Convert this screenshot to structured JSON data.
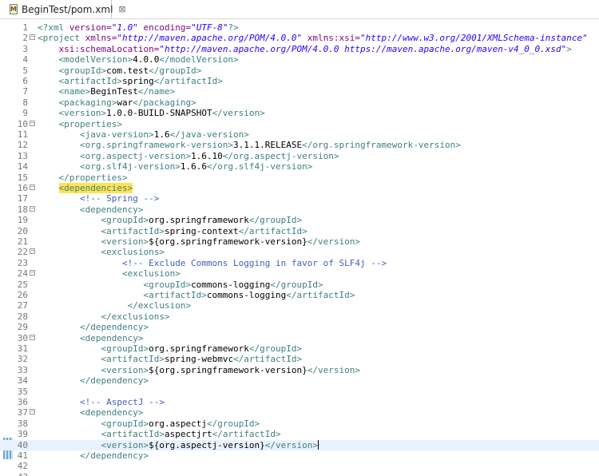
{
  "editor_tab": {
    "icon": "M",
    "title": "BeginTest/pom.xml",
    "close_glyph": "⊠"
  },
  "lines": [
    {
      "num": "1",
      "fold": "",
      "indent": "",
      "segs": [
        [
          "tag",
          "<?xml "
        ],
        [
          "attr",
          "version="
        ],
        [
          "val",
          "\"1.0\""
        ],
        [
          "attr",
          " encoding="
        ],
        [
          "val",
          "\"UTF-8\""
        ],
        [
          "tag",
          "?>"
        ]
      ]
    },
    {
      "num": "2",
      "fold": "⊖",
      "indent": "",
      "segs": [
        [
          "tag",
          "<project "
        ],
        [
          "attr",
          "xmlns="
        ],
        [
          "val",
          "\"http://maven.apache.org/POM/4.0.0\""
        ],
        [
          "attr",
          " xmlns:xsi="
        ],
        [
          "val",
          "\"http://www.w3.org/2001/XMLSchema-instance\""
        ]
      ]
    },
    {
      "num": "3",
      "fold": "",
      "indent": "    ",
      "segs": [
        [
          "attr",
          "xsi:schemaLocation="
        ],
        [
          "val",
          "\"http://maven.apache.org/POM/4.0.0 https://maven.apache.org/maven-v4_0_0.xsd\""
        ],
        [
          "tag",
          ">"
        ]
      ]
    },
    {
      "num": "4",
      "fold": "",
      "indent": "    ",
      "segs": [
        [
          "tag",
          "<modelVersion>"
        ],
        [
          "text",
          "4.0.0"
        ],
        [
          "tag",
          "</modelVersion>"
        ]
      ]
    },
    {
      "num": "5",
      "fold": "",
      "indent": "    ",
      "segs": [
        [
          "tag",
          "<groupId>"
        ],
        [
          "text",
          "com.test"
        ],
        [
          "tag",
          "</groupId>"
        ]
      ]
    },
    {
      "num": "6",
      "fold": "",
      "indent": "    ",
      "segs": [
        [
          "tag",
          "<artifactId>"
        ],
        [
          "text",
          "spring"
        ],
        [
          "tag",
          "</artifactId>"
        ]
      ]
    },
    {
      "num": "7",
      "fold": "",
      "indent": "    ",
      "segs": [
        [
          "tag",
          "<name>"
        ],
        [
          "text",
          "BeginTest"
        ],
        [
          "tag",
          "</name>"
        ]
      ]
    },
    {
      "num": "8",
      "fold": "",
      "indent": "    ",
      "segs": [
        [
          "tag",
          "<packaging>"
        ],
        [
          "text",
          "war"
        ],
        [
          "tag",
          "</packaging>"
        ]
      ]
    },
    {
      "num": "9",
      "fold": "",
      "indent": "    ",
      "segs": [
        [
          "tag",
          "<version>"
        ],
        [
          "text",
          "1.0.0-BUILD-SNAPSHOT"
        ],
        [
          "tag",
          "</version>"
        ]
      ]
    },
    {
      "num": "10",
      "fold": "⊖",
      "indent": "    ",
      "segs": [
        [
          "tag",
          "<properties>"
        ]
      ]
    },
    {
      "num": "11",
      "fold": "",
      "indent": "        ",
      "segs": [
        [
          "tag",
          "<java-version>"
        ],
        [
          "text",
          "1.6"
        ],
        [
          "tag",
          "</java-version>"
        ]
      ]
    },
    {
      "num": "12",
      "fold": "",
      "indent": "        ",
      "segs": [
        [
          "tag",
          "<org.springframework-version>"
        ],
        [
          "text",
          "3.1.1.RELEASE"
        ],
        [
          "tag",
          "</org.springframework-version>"
        ]
      ]
    },
    {
      "num": "13",
      "fold": "",
      "indent": "        ",
      "segs": [
        [
          "tag",
          "<org.aspectj-version>"
        ],
        [
          "text",
          "1.6.10"
        ],
        [
          "tag",
          "</org.aspectj-version>"
        ]
      ]
    },
    {
      "num": "14",
      "fold": "",
      "indent": "        ",
      "segs": [
        [
          "tag",
          "<org.slf4j-version>"
        ],
        [
          "text",
          "1.6.6"
        ],
        [
          "tag",
          "</org.slf4j-version>"
        ]
      ]
    },
    {
      "num": "15",
      "fold": "",
      "indent": "    ",
      "segs": [
        [
          "tag",
          "</properties>"
        ]
      ]
    },
    {
      "num": "16",
      "fold": "⊖",
      "indent": "    ",
      "segs": [
        [
          "tag hl",
          "<dependencies>"
        ]
      ]
    },
    {
      "num": "17",
      "fold": "",
      "indent": "        ",
      "segs": [
        [
          "com",
          "<!-- Spring -->"
        ]
      ]
    },
    {
      "num": "18",
      "fold": "⊖",
      "indent": "        ",
      "segs": [
        [
          "tag",
          "<dependency>"
        ]
      ]
    },
    {
      "num": "19",
      "fold": "",
      "indent": "            ",
      "segs": [
        [
          "tag",
          "<groupId>"
        ],
        [
          "text",
          "org.springframework"
        ],
        [
          "tag",
          "</groupId>"
        ]
      ]
    },
    {
      "num": "20",
      "fold": "",
      "indent": "            ",
      "segs": [
        [
          "tag",
          "<artifactId>"
        ],
        [
          "text",
          "spring-context"
        ],
        [
          "tag",
          "</artifactId>"
        ]
      ]
    },
    {
      "num": "21",
      "fold": "",
      "indent": "            ",
      "segs": [
        [
          "tag",
          "<version>"
        ],
        [
          "text",
          "${org.springframework-version}"
        ],
        [
          "tag",
          "</version>"
        ]
      ]
    },
    {
      "num": "22",
      "fold": "⊖",
      "indent": "            ",
      "segs": [
        [
          "tag",
          "<exclusions>"
        ]
      ]
    },
    {
      "num": "23",
      "fold": "",
      "indent": "                ",
      "segs": [
        [
          "com",
          "<!-- Exclude Commons Logging in favor of SLF4j -->"
        ]
      ]
    },
    {
      "num": "24",
      "fold": "⊖",
      "indent": "                ",
      "segs": [
        [
          "tag",
          "<exclusion>"
        ]
      ]
    },
    {
      "num": "25",
      "fold": "",
      "indent": "                    ",
      "segs": [
        [
          "tag",
          "<groupId>"
        ],
        [
          "text",
          "commons-logging"
        ],
        [
          "tag",
          "</groupId>"
        ]
      ]
    },
    {
      "num": "26",
      "fold": "",
      "indent": "                    ",
      "segs": [
        [
          "tag",
          "<artifactId>"
        ],
        [
          "text",
          "commons-logging"
        ],
        [
          "tag",
          "</artifactId>"
        ]
      ]
    },
    {
      "num": "27",
      "fold": "",
      "indent": "                 ",
      "segs": [
        [
          "tag",
          "</exclusion>"
        ]
      ]
    },
    {
      "num": "28",
      "fold": "",
      "indent": "            ",
      "segs": [
        [
          "tag",
          "</exclusions>"
        ]
      ]
    },
    {
      "num": "29",
      "fold": "",
      "indent": "        ",
      "segs": [
        [
          "tag",
          "</dependency>"
        ]
      ]
    },
    {
      "num": "30",
      "fold": "⊖",
      "indent": "        ",
      "segs": [
        [
          "tag",
          "<dependency>"
        ]
      ]
    },
    {
      "num": "31",
      "fold": "",
      "indent": "            ",
      "segs": [
        [
          "tag",
          "<groupId>"
        ],
        [
          "text",
          "org.springframework"
        ],
        [
          "tag",
          "</groupId>"
        ]
      ]
    },
    {
      "num": "32",
      "fold": "",
      "indent": "            ",
      "segs": [
        [
          "tag",
          "<artifactId>"
        ],
        [
          "text",
          "spring-webmvc"
        ],
        [
          "tag",
          "</artifactId>"
        ]
      ]
    },
    {
      "num": "33",
      "fold": "",
      "indent": "            ",
      "segs": [
        [
          "tag",
          "<version>"
        ],
        [
          "text",
          "${org.springframework-version}"
        ],
        [
          "tag",
          "</version>"
        ]
      ]
    },
    {
      "num": "34",
      "fold": "",
      "indent": "        ",
      "segs": [
        [
          "tag",
          "</dependency>"
        ]
      ]
    },
    {
      "num": "35",
      "fold": "",
      "indent": "",
      "segs": []
    },
    {
      "num": "36",
      "fold": "",
      "indent": "        ",
      "segs": [
        [
          "com",
          "<!-- AspectJ -->"
        ]
      ]
    },
    {
      "num": "37",
      "fold": "⊖",
      "indent": "        ",
      "segs": [
        [
          "tag",
          "<dependency>"
        ]
      ]
    },
    {
      "num": "38",
      "fold": "",
      "indent": "            ",
      "segs": [
        [
          "tag",
          "<groupId>"
        ],
        [
          "text",
          "org.aspectj"
        ],
        [
          "tag",
          "</groupId>"
        ]
      ]
    },
    {
      "num": "39",
      "fold": "",
      "indent": "            ",
      "segs": [
        [
          "tag",
          "<artifactId>"
        ],
        [
          "text",
          "aspectjrt"
        ],
        [
          "tag",
          "</artifactId>"
        ]
      ]
    },
    {
      "num": "40",
      "fold": "",
      "indent": "            ",
      "current": true,
      "segs": [
        [
          "tag",
          "<version>"
        ],
        [
          "text",
          "${org.aspectj-version}"
        ],
        [
          "tag",
          "</version>"
        ]
      ]
    },
    {
      "num": "41",
      "fold": "",
      "indent": "        ",
      "segs": [
        [
          "tag",
          "</dependency>"
        ]
      ]
    },
    {
      "num": "42",
      "fold": "",
      "indent": "",
      "segs": []
    },
    {
      "num": "43",
      "fold": "",
      "indent": "",
      "segs": []
    }
  ]
}
